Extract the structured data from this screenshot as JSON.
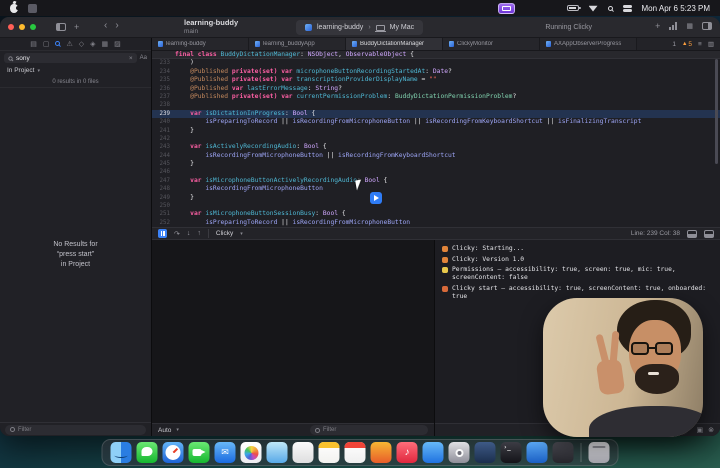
{
  "colors": {
    "accent": "#3b82f7",
    "kw": "#fc5fa3",
    "attr": "#c2885d",
    "typ": "#d0a8ff",
    "ptyp": "#82d4b1",
    "decl": "#4fb8d4",
    "ref": "#9ea6f7",
    "str": "#fc6a5d",
    "warn": "#fd9f3f",
    "curline": "rgba(45,95,170,0.33)"
  },
  "menubar": {
    "time": "Mon Apr 6 5:23 PM"
  },
  "window": {
    "titlebar": {
      "project": "learning-buddy",
      "branch": "main",
      "scheme": "learning-buddy",
      "destination": "My Mac",
      "status": "Running Clicky"
    },
    "tabs": {
      "active": 2,
      "items": [
        {
          "label": "learning-buddy"
        },
        {
          "label": "learning_buddyApp"
        },
        {
          "label": "BuddyDictationManager"
        },
        {
          "label": "ClickyMonitor"
        },
        {
          "label": "AXAppObserverProgress"
        }
      ]
    },
    "issues": {
      "errors": "1",
      "warnings": "5"
    },
    "navigator": {
      "icons": [
        {
          "name": "project-navigator-icon",
          "glyph": "▤"
        },
        {
          "name": "bookmarks-navigator-icon",
          "glyph": "▢"
        },
        {
          "name": "search-navigator-icon",
          "glyph": "",
          "active": true
        },
        {
          "name": "issues-navigator-icon",
          "glyph": "⚠"
        },
        {
          "name": "tests-navigator-icon",
          "glyph": "◇"
        },
        {
          "name": "debug-navigator-icon",
          "glyph": "◈"
        },
        {
          "name": "breakpoints-navigator-icon",
          "glyph": "▦"
        },
        {
          "name": "reports-navigator-icon",
          "glyph": "▨"
        }
      ],
      "search_value": "sony",
      "case_label": "Aa",
      "scope": "In Project",
      "results": "0 results in 0 files",
      "empty1": "No Results for",
      "empty2": "“press start”",
      "empty3": "in Project",
      "filter_label": "Filter"
    },
    "editor": {
      "sticky": {
        "segs": [
          [
            "k",
            "final"
          ],
          [
            "p",
            " "
          ],
          [
            "k",
            "class"
          ],
          [
            "p",
            " "
          ],
          [
            "d",
            "BuddyDictationManager"
          ],
          [
            "p",
            ": "
          ],
          [
            "t",
            "NSObject"
          ],
          [
            "p",
            ", "
          ],
          [
            "t",
            "ObservableObject"
          ],
          [
            "p",
            " {"
          ]
        ]
      },
      "lines": [
        {
          "n": "233",
          "segs": [
            [
              "p",
              "    )"
            ]
          ]
        },
        {
          "n": "234",
          "segs": [
            [
              "p",
              "    "
            ],
            [
              "a",
              "@Published"
            ],
            [
              "p",
              " "
            ],
            [
              "k",
              "private(set)"
            ],
            [
              "p",
              " "
            ],
            [
              "k",
              "var"
            ],
            [
              "p",
              " "
            ],
            [
              "d",
              "microphoneButtonRecordingStartedAt"
            ],
            [
              "p",
              ": "
            ],
            [
              "t",
              "Date"
            ],
            [
              "p",
              "?"
            ]
          ]
        },
        {
          "n": "235",
          "segs": [
            [
              "p",
              "    "
            ],
            [
              "a",
              "@Published"
            ],
            [
              "p",
              " "
            ],
            [
              "k",
              "private(set)"
            ],
            [
              "p",
              " "
            ],
            [
              "k",
              "var"
            ],
            [
              "p",
              " "
            ],
            [
              "d",
              "transcriptionProviderDisplayName"
            ],
            [
              "p",
              " = "
            ],
            [
              "s",
              "\"\""
            ]
          ]
        },
        {
          "n": "236",
          "segs": [
            [
              "p",
              "    "
            ],
            [
              "a",
              "@Published"
            ],
            [
              "p",
              " "
            ],
            [
              "k",
              "var"
            ],
            [
              "p",
              " "
            ],
            [
              "d",
              "lastErrorMessage"
            ],
            [
              "p",
              ": "
            ],
            [
              "t",
              "String"
            ],
            [
              "p",
              "?"
            ]
          ]
        },
        {
          "n": "237",
          "segs": [
            [
              "p",
              "    "
            ],
            [
              "a",
              "@Published"
            ],
            [
              "p",
              " "
            ],
            [
              "k",
              "private(set)"
            ],
            [
              "p",
              " "
            ],
            [
              "k",
              "var"
            ],
            [
              "p",
              " "
            ],
            [
              "d",
              "currentPermissionProblem"
            ],
            [
              "p",
              ": "
            ],
            [
              "pt",
              "BuddyDictationPermissionProblem"
            ],
            [
              "p",
              "?"
            ]
          ]
        },
        {
          "n": "238",
          "segs": []
        },
        {
          "n": "239",
          "cur": true,
          "segs": [
            [
              "p",
              "    "
            ],
            [
              "k",
              "var"
            ],
            [
              "p",
              " "
            ],
            [
              "d",
              "isDictationInProgress"
            ],
            [
              "p",
              ": "
            ],
            [
              "t",
              "Bool"
            ],
            [
              "p",
              " {"
            ]
          ]
        },
        {
          "n": "240",
          "segs": [
            [
              "p",
              "        "
            ],
            [
              "r",
              "isPreparingToRecord"
            ],
            [
              "p",
              " || "
            ],
            [
              "r",
              "isRecordingFromMicrophoneButton"
            ],
            [
              "p",
              " || "
            ],
            [
              "r",
              "isRecordingFromKeyboardShortcut"
            ],
            [
              "p",
              " || "
            ],
            [
              "r",
              "isFinalizingTranscript"
            ]
          ]
        },
        {
          "n": "241",
          "segs": [
            [
              "p",
              "    }"
            ]
          ]
        },
        {
          "n": "242",
          "segs": []
        },
        {
          "n": "243",
          "segs": [
            [
              "p",
              "    "
            ],
            [
              "k",
              "var"
            ],
            [
              "p",
              " "
            ],
            [
              "d",
              "isActivelyRecordingAudio"
            ],
            [
              "p",
              ": "
            ],
            [
              "t",
              "Bool"
            ],
            [
              "p",
              " {"
            ]
          ]
        },
        {
          "n": "244",
          "segs": [
            [
              "p",
              "        "
            ],
            [
              "r",
              "isRecordingFromMicrophoneButton"
            ],
            [
              "p",
              " || "
            ],
            [
              "r",
              "isRecordingFromKeyboardShortcut"
            ]
          ]
        },
        {
          "n": "245",
          "segs": [
            [
              "p",
              "    }"
            ]
          ]
        },
        {
          "n": "246",
          "segs": []
        },
        {
          "n": "247",
          "segs": [
            [
              "p",
              "    "
            ],
            [
              "k",
              "var"
            ],
            [
              "p",
              " "
            ],
            [
              "d",
              "isMicrophoneButtonActivelyRecordingAudio"
            ],
            [
              "p",
              ": "
            ],
            [
              "t",
              "Bool"
            ],
            [
              "p",
              " {"
            ]
          ]
        },
        {
          "n": "248",
          "segs": [
            [
              "p",
              "        "
            ],
            [
              "r",
              "isRecordingFromMicrophoneButton"
            ]
          ]
        },
        {
          "n": "249",
          "segs": [
            [
              "p",
              "    }"
            ]
          ]
        },
        {
          "n": "250",
          "segs": []
        },
        {
          "n": "251",
          "segs": [
            [
              "p",
              "    "
            ],
            [
              "k",
              "var"
            ],
            [
              "p",
              " "
            ],
            [
              "d",
              "isMicrophoneButtonSessionBusy"
            ],
            [
              "p",
              ": "
            ],
            [
              "t",
              "Bool"
            ],
            [
              "p",
              " {"
            ]
          ]
        },
        {
          "n": "252",
          "segs": [
            [
              "p",
              "        "
            ],
            [
              "r",
              "isPreparingToRecord"
            ],
            [
              "p",
              " || "
            ],
            [
              "r",
              "isRecordingFromMicrophoneButton"
            ]
          ]
        }
      ]
    },
    "debugbar": {
      "process": "Clicky",
      "position": "Line: 239 Col: 38"
    },
    "variables": {
      "scope": "Auto",
      "filter_label": "Filter"
    },
    "console": {
      "filter_label": "Filter",
      "lines": [
        {
          "icon": "mouse",
          "text": "Clicky: Starting..."
        },
        {
          "icon": "mouse",
          "text": "Clicky: Version 1.0"
        },
        {
          "icon": "key",
          "text": "Permissions — accessibility: true, screen: true, mic: true, screenContent: false"
        },
        {
          "icon": "hammer",
          "text": "Clicky start — accessibility: true, screenContent: true, onboarded: true"
        }
      ]
    }
  },
  "dock": {
    "icons": [
      {
        "name": "finder",
        "c1": "#7fc9f5",
        "c2": "#1d6fd4",
        "d": "finder"
      },
      {
        "name": "messages",
        "c1": "#6ae873",
        "c2": "#15b62f",
        "d": "bubble"
      },
      {
        "name": "safari",
        "c1": "#63b5f8",
        "c2": "#1e63d6",
        "d": "safari"
      },
      {
        "name": "facetime",
        "c1": "#6ae873",
        "c2": "#15b62f",
        "d": "cam"
      },
      {
        "name": "mail",
        "c1": "#68b8f8",
        "c2": "#1a6ae0",
        "d": "mail"
      },
      {
        "name": "photos",
        "c1": "#ffffff",
        "c2": "#ececf0",
        "d": "photos"
      },
      {
        "name": "maps",
        "c1": "#bfe7f7",
        "c2": "#58a9e8",
        "d": ""
      },
      {
        "name": "freeform",
        "c1": "#fafafa",
        "c2": "#dededf",
        "d": ""
      },
      {
        "name": "notes",
        "c1": "#ffffff",
        "c2": "#f2f2ef",
        "d": "notes"
      },
      {
        "name": "calendar",
        "c1": "#ffffff",
        "c2": "#efefef",
        "d": "calendar"
      },
      {
        "name": "launchpad",
        "c1": "#f7b733",
        "c2": "#e85d2a",
        "d": ""
      },
      {
        "name": "music",
        "c1": "#ff6d7a",
        "c2": "#e0273e",
        "d": "music"
      },
      {
        "name": "app-store",
        "c1": "#66b9f8",
        "c2": "#1f72e0",
        "d": ""
      },
      {
        "name": "system-settings",
        "c1": "#e0e0e4",
        "c2": "#8f8f99",
        "d": "settings"
      },
      {
        "name": "xcode",
        "c1": "#3e5a86",
        "c2": "#1b2e4d",
        "d": ""
      },
      {
        "name": "terminal",
        "c1": "#3c3c44",
        "c2": "#141419",
        "d": "terminal"
      },
      {
        "name": "vscode",
        "c1": "#5aa7f2",
        "c2": "#1a5fc4",
        "d": ""
      },
      {
        "name": "utility",
        "c1": "#4a4a52",
        "c2": "#26262c",
        "d": ""
      },
      {
        "name": "trash",
        "c1": "#e2e2e6",
        "c2": "#a6a6ae",
        "d": "trash",
        "sep": true
      }
    ]
  }
}
